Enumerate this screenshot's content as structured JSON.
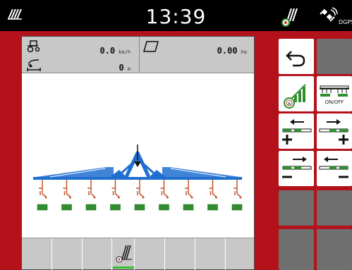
{
  "status_bar": {
    "time": "13:39",
    "gps_label": "DGPS"
  },
  "stats": {
    "speed_value": "0.0",
    "speed_unit": "km/h",
    "distance_value": "0",
    "distance_unit": "m",
    "area_value": "0.00",
    "area_unit": "ha"
  },
  "machine": {
    "row_units": 9
  },
  "buttons": {
    "section_onoff_label": "ON/OFF"
  },
  "colors": {
    "frame": "#b3121b",
    "boom": "#1f6fd1",
    "row_unit": "#c0572a",
    "section_active": "#2f8f2f",
    "active_tab": "#30c030"
  },
  "icons": {
    "back": "back-arrow-icon",
    "auto_section": "auto-section-control-icon",
    "section_onoff": "section-onoff-icon",
    "section_add_left": "add-section-left-icon",
    "section_add_right": "add-section-right-icon",
    "section_remove_left": "remove-section-left-icon",
    "section_remove_right": "remove-section-right-icon"
  }
}
